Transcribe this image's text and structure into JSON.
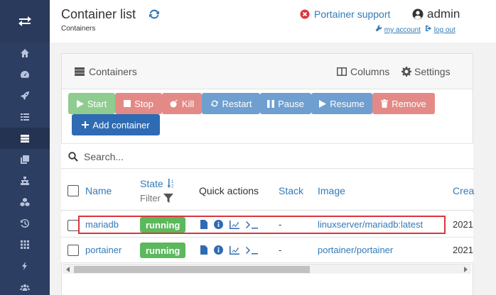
{
  "header": {
    "title": "Container list",
    "breadcrumb": "Containers",
    "support_label": "Portainer support",
    "user_name": "admin",
    "my_account": "my account",
    "log_out": "log out"
  },
  "sidebar": {
    "items": [
      {
        "icon": "home-icon"
      },
      {
        "icon": "dashboard-icon"
      },
      {
        "icon": "rocket-icon"
      },
      {
        "icon": "list-icon"
      },
      {
        "icon": "server-icon",
        "active": true
      },
      {
        "icon": "clone-icon"
      },
      {
        "icon": "sitemap-icon"
      },
      {
        "icon": "cubes-icon"
      },
      {
        "icon": "history-icon"
      },
      {
        "icon": "grid-icon"
      },
      {
        "icon": "bolt-icon"
      },
      {
        "icon": "users-icon"
      }
    ]
  },
  "panel": {
    "title": "Containers",
    "columns_label": "Columns",
    "settings_label": "Settings"
  },
  "actions": {
    "start": "Start",
    "stop": "Stop",
    "kill": "Kill",
    "restart": "Restart",
    "pause": "Pause",
    "resume": "Resume",
    "remove": "Remove",
    "add": "Add container"
  },
  "search": {
    "placeholder": "Search..."
  },
  "table": {
    "columns": {
      "name": "Name",
      "state": "State",
      "filter": "Filter",
      "quick_actions": "Quick actions",
      "stack": "Stack",
      "image": "Image",
      "created": "Crea"
    },
    "rows": [
      {
        "name": "mariadb",
        "state": "running",
        "stack": "-",
        "image": "linuxserver/mariadb:latest",
        "created": "2021"
      },
      {
        "name": "portainer",
        "state": "running",
        "stack": "-",
        "image": "portainer/portainer",
        "created": "2021"
      }
    ]
  },
  "colors": {
    "sidebar": "#2d3e63",
    "link": "#337ab7",
    "running": "#5cb85c",
    "highlight": "#d9363e"
  }
}
